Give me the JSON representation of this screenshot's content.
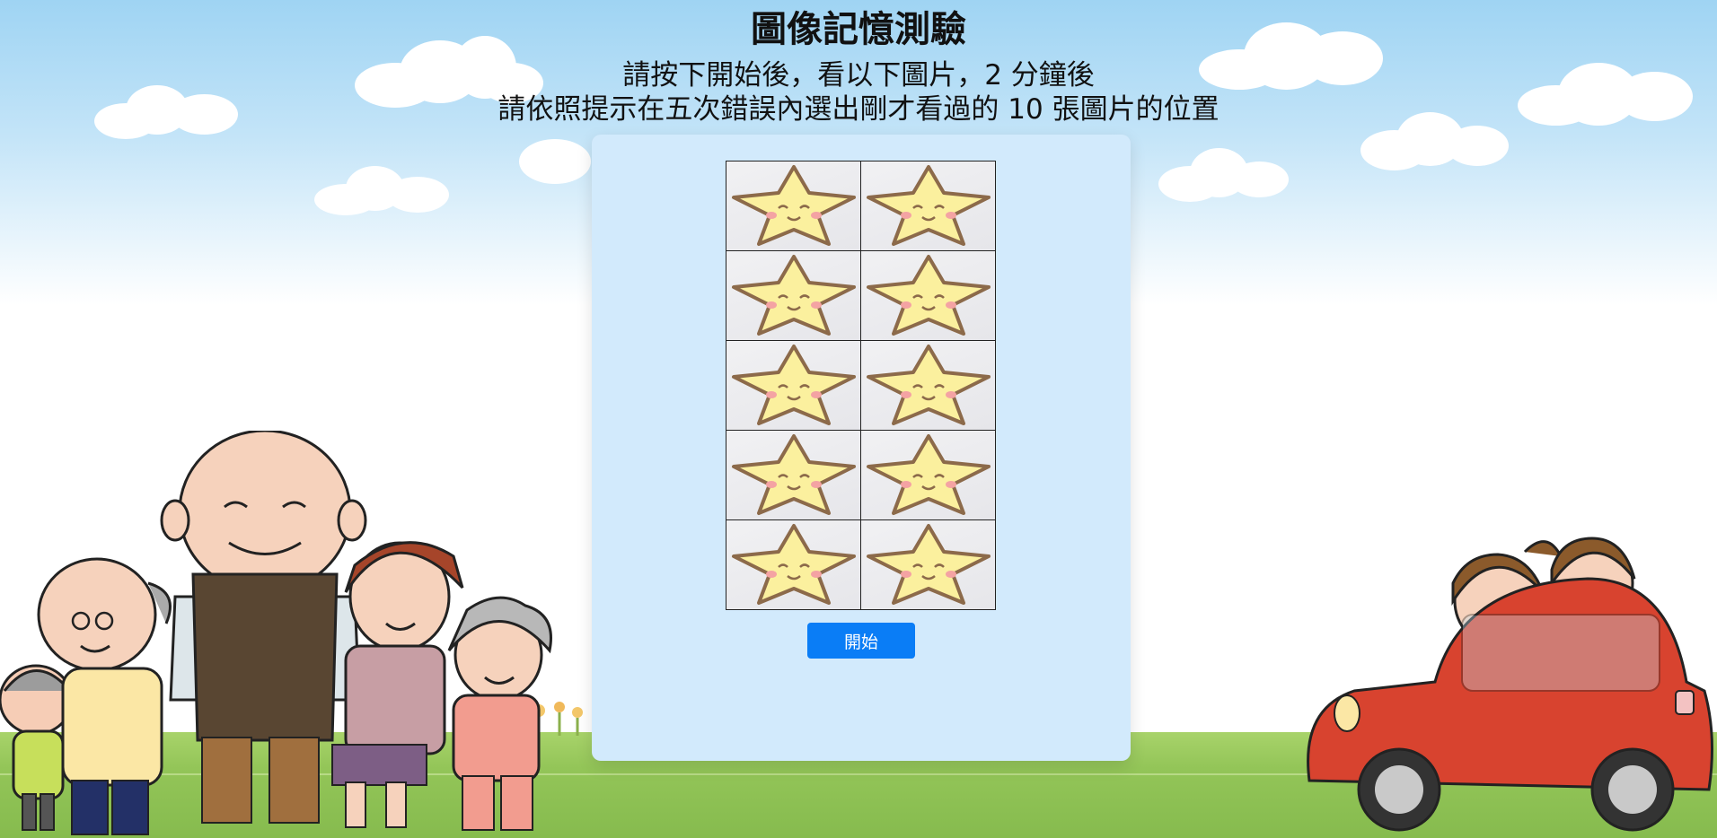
{
  "page": {
    "title": "圖像記憶測驗",
    "instruction_line1": "請按下開始後，看以下圖片，2 分鐘後",
    "instruction_line2": "請依照提示在五次錯誤內選出剛才看過的 10 張圖片的位置"
  },
  "grid": {
    "cells": [
      {
        "icon": "smiling-star-icon"
      },
      {
        "icon": "smiling-star-icon"
      },
      {
        "icon": "smiling-star-icon"
      },
      {
        "icon": "smiling-star-icon"
      },
      {
        "icon": "smiling-star-icon"
      },
      {
        "icon": "smiling-star-icon"
      },
      {
        "icon": "smiling-star-icon"
      },
      {
        "icon": "smiling-star-icon"
      },
      {
        "icon": "smiling-star-icon"
      },
      {
        "icon": "smiling-star-icon"
      }
    ]
  },
  "controls": {
    "start_label": "開始"
  },
  "colors": {
    "panel_bg": "#d2eafc",
    "button_bg": "#0a7df6",
    "star_fill": "#fbf09e",
    "star_stroke": "#8c6a4a"
  }
}
